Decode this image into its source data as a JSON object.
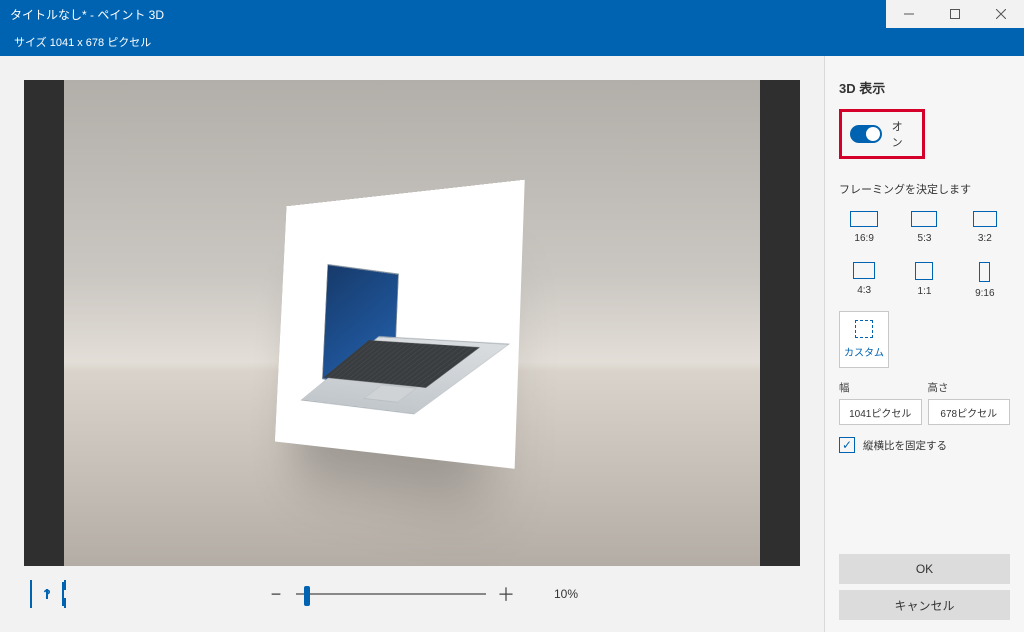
{
  "titlebar": {
    "title": "タイトルなし* - ペイント 3D",
    "size_text": "サイズ  1041 x 678 ピクセル"
  },
  "zoom": {
    "minus": "−",
    "plus": "＋",
    "value_text": "10%",
    "value_pct": 10
  },
  "side": {
    "heading": "3D 表示",
    "toggle_label": "オン",
    "framing_label": "フレーミングを決定します",
    "ratios": {
      "r16x9": "16:9",
      "r5x3": "5:3",
      "r3x2": "3:2",
      "r4x3": "4:3",
      "r1x1": "1:1",
      "r9x16": "9:16",
      "custom": "カスタム"
    },
    "width_label": "幅",
    "height_label": "高さ",
    "width_value": "1041ピクセル",
    "height_value": "678ピクセル",
    "lock_aspect": "縦横比を固定する",
    "ok": "OK",
    "cancel": "キャンセル"
  },
  "fit_icon": "?"
}
